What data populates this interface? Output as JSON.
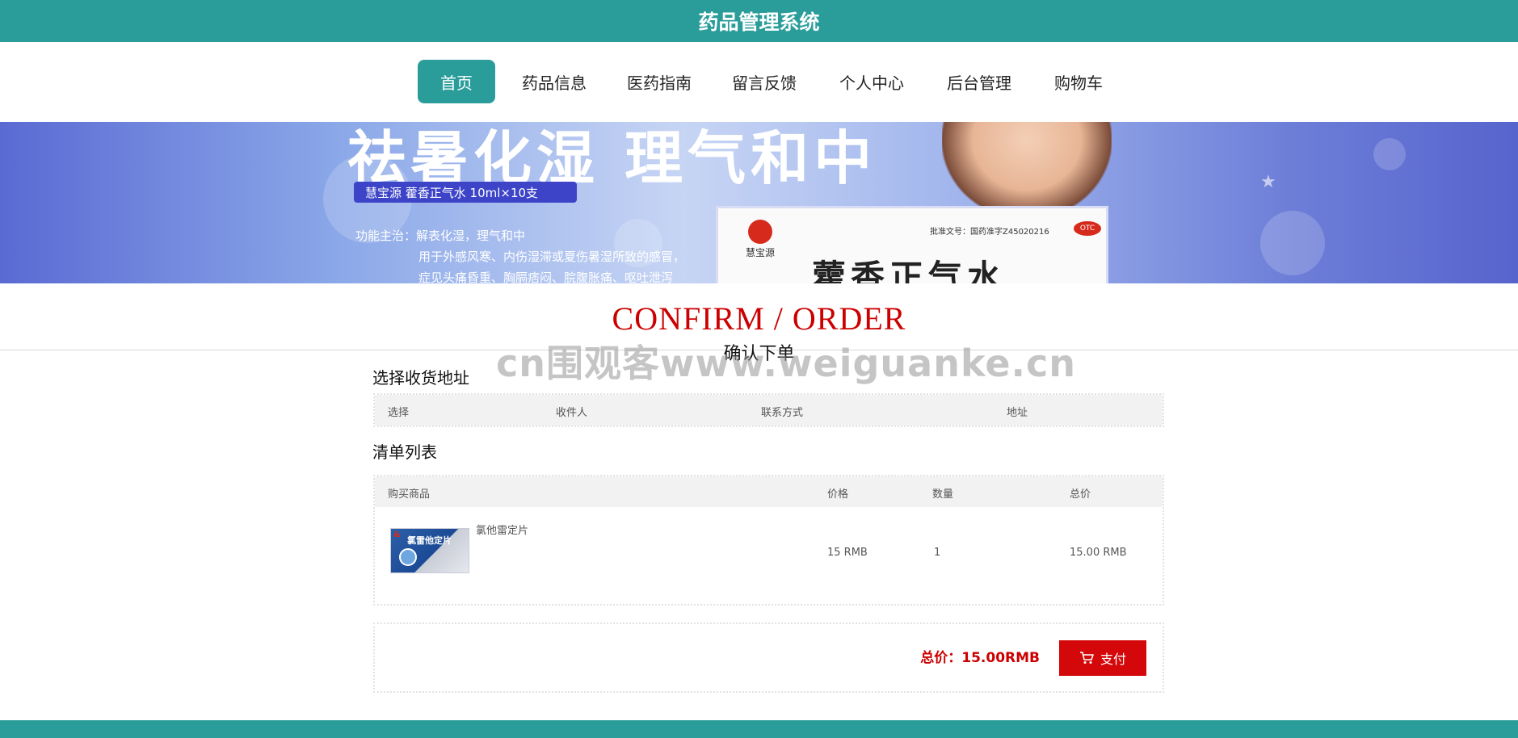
{
  "header": {
    "title": "药品管理系统"
  },
  "nav": {
    "items": [
      {
        "label": "首页",
        "active": true
      },
      {
        "label": "药品信息"
      },
      {
        "label": "医药指南"
      },
      {
        "label": "留言反馈"
      },
      {
        "label": "个人中心"
      },
      {
        "label": "后台管理"
      },
      {
        "label": "购物车"
      }
    ]
  },
  "banner": {
    "headline": "祛暑化湿  理气和中",
    "tag": "慧宝源    藿香正气水 10ml×10支",
    "desc_line1": "功能主治：解表化湿，理气和中",
    "desc_line2": "用于外感风寒、内伤湿滞或夏伤暑湿所致的感冒，",
    "desc_line3": "症见头痛昏重、胸膈痞闷、脘腹胀痛、呕吐泄泻",
    "brand": "慧宝源",
    "license": "批准文号：国药准字Z45020216",
    "otc": "OTC",
    "product_name": "藿香正气水"
  },
  "section": {
    "heading": "CONFIRM / ORDER",
    "subheading": "确认下单"
  },
  "watermark": "cn围观客www.weiguanke.cn",
  "address": {
    "title": "选择收货地址",
    "columns": [
      "选择",
      "收件人",
      "联系方式",
      "地址"
    ]
  },
  "order_list": {
    "title": "清单列表",
    "columns": [
      "购买商品",
      "价格",
      "数量",
      "总价"
    ],
    "rows": [
      {
        "product_name": "氯他雷定片",
        "image_label": "氯雷他定片",
        "price": "15 RMB",
        "quantity": "1",
        "total": "15.00 RMB"
      }
    ]
  },
  "summary": {
    "total_label": "总价：15.00RMB",
    "pay_label": "支付"
  },
  "colors": {
    "primary": "#2a9d9b",
    "accent_red": "#cc0000",
    "pay_button": "#d4080a"
  }
}
